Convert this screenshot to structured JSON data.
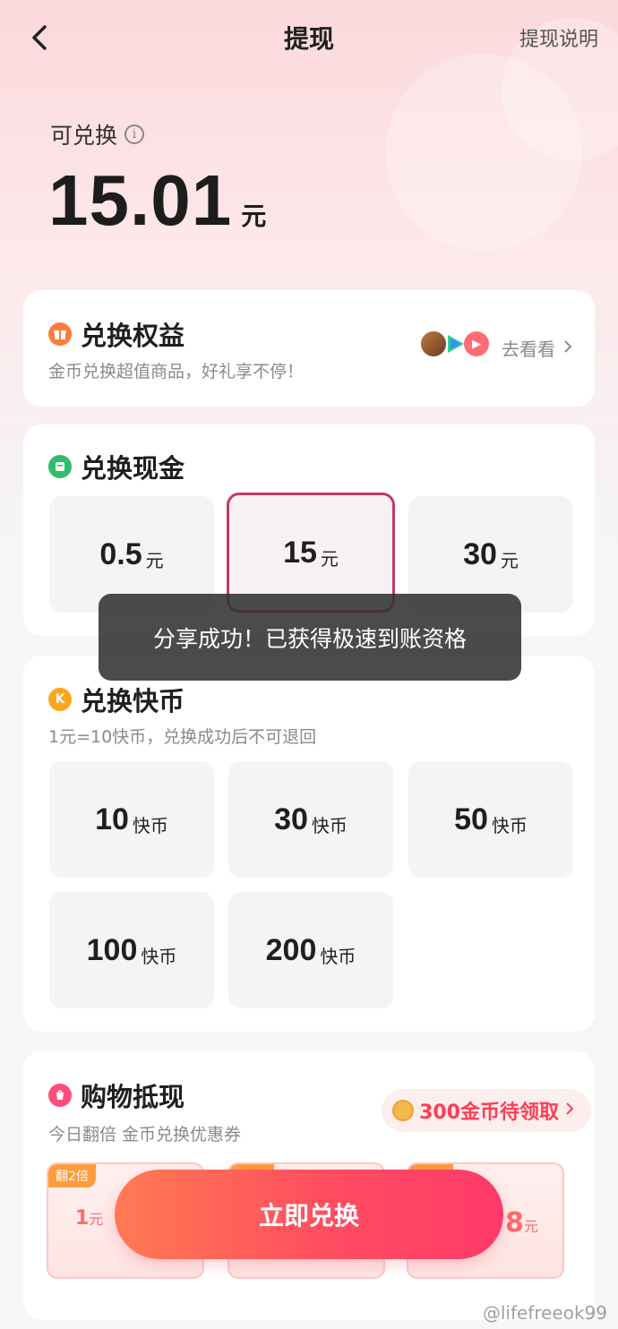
{
  "header": {
    "title": "提现",
    "help_label": "提现说明"
  },
  "balance": {
    "label": "可兑换",
    "amount": "15.01",
    "unit": "元"
  },
  "benefits": {
    "title": "兑换权益",
    "subtitle": "金币兑换超值商品，好礼享不停！",
    "link_label": "去看看"
  },
  "cash": {
    "title": "兑换现金",
    "options": [
      {
        "value": "0.5",
        "unit": "元",
        "selected": false
      },
      {
        "value": "15",
        "unit": "元",
        "selected": true
      },
      {
        "value": "30",
        "unit": "元",
        "selected": false
      }
    ]
  },
  "toast": {
    "text": "分享成功！已获得极速到账资格"
  },
  "kuaibi": {
    "title": "兑换快币",
    "subtitle": "1元=10快币，兑换成功后不可退回",
    "options": [
      {
        "value": "10",
        "unit": "快币"
      },
      {
        "value": "30",
        "unit": "快币"
      },
      {
        "value": "50",
        "unit": "快币"
      },
      {
        "value": "100",
        "unit": "快币"
      },
      {
        "value": "200",
        "unit": "快币"
      }
    ]
  },
  "shopping": {
    "title": "购物抵现",
    "subtitle": "今日翻倍 金币兑换优惠券",
    "pending_label": "300金币待领取",
    "coupons": [
      {
        "tag": "翻2倍",
        "amount": "1",
        "unit": "元"
      },
      {
        "tag": "",
        "amount": "",
        "unit": ""
      },
      {
        "tag": "",
        "amount": "8",
        "unit": "元"
      }
    ]
  },
  "cta": {
    "label": "立即兑换"
  },
  "watermark": "@lifefreeok99",
  "colors": {
    "accent": "#ff4d60",
    "selected_border": "#c53a5e"
  }
}
